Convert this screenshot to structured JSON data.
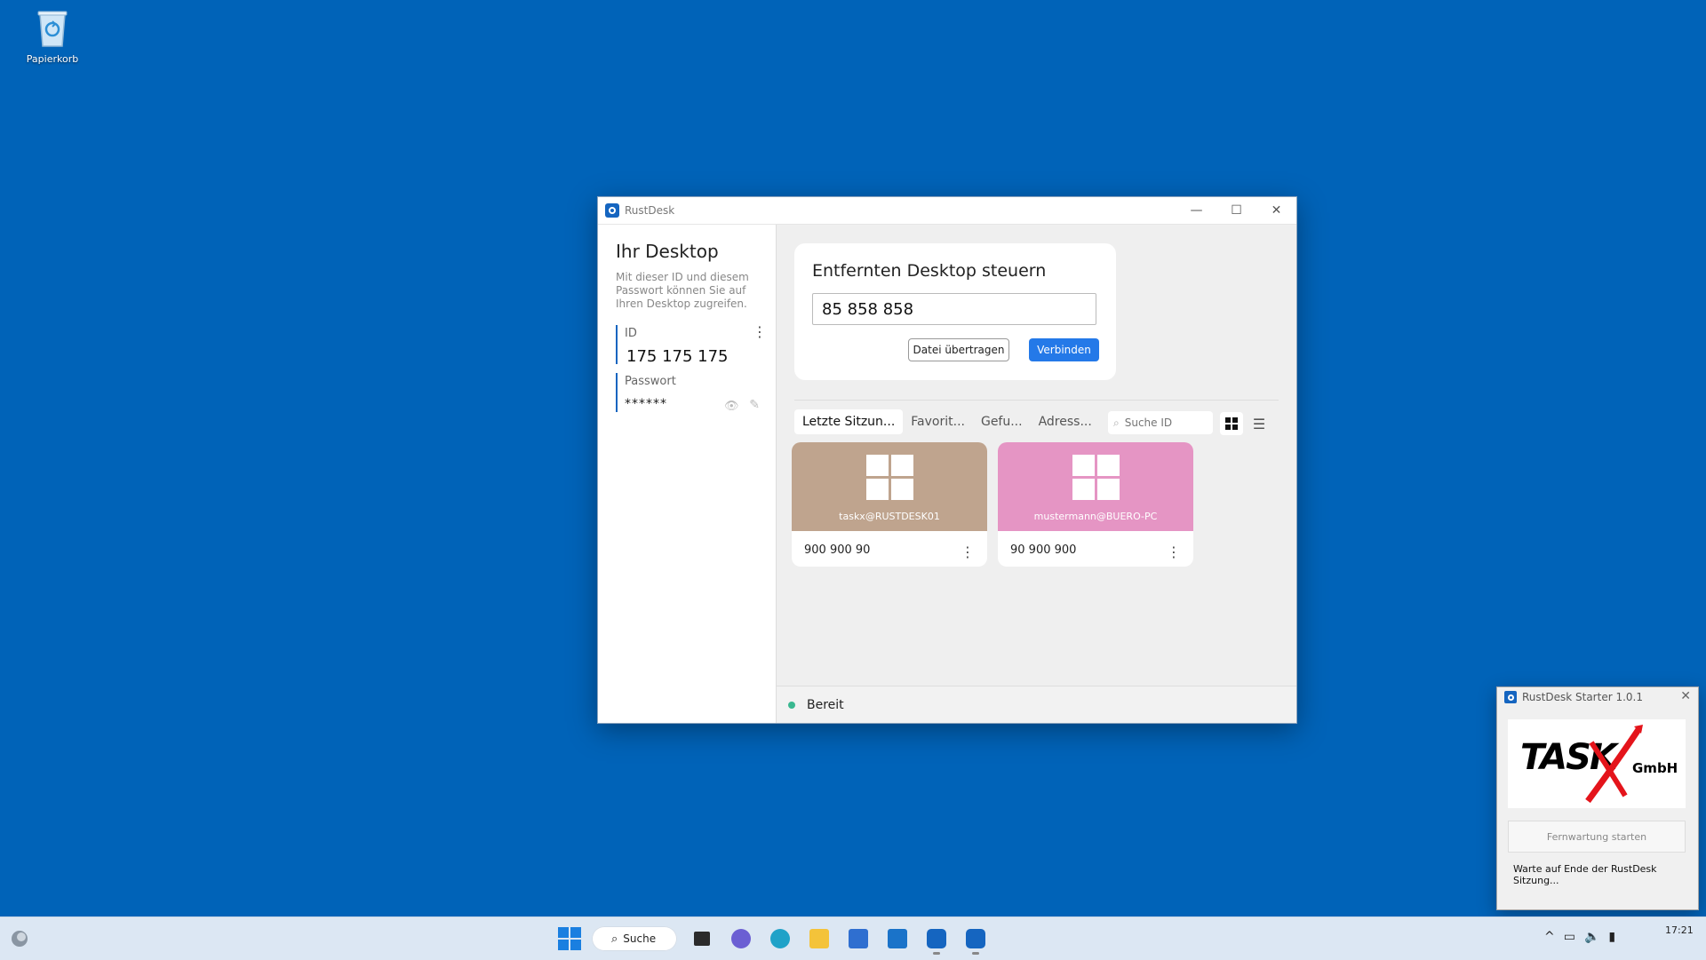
{
  "desktop": {
    "recycle_bin_label": "Papierkorb"
  },
  "window": {
    "title": "RustDesk",
    "controls": {
      "minimize": "—",
      "maximize": "☐",
      "close": "✕"
    }
  },
  "left_panel": {
    "heading": "Ihr Desktop",
    "description": "Mit dieser ID und diesem Passwort können Sie auf Ihren Desktop zugreifen.",
    "id_label": "ID",
    "id_value": "175 175 175",
    "password_label": "Passwort",
    "password_value": "******"
  },
  "connect_card": {
    "heading": "Entfernten Desktop steuern",
    "remote_id_value": "85 858 858",
    "transfer_button": "Datei übertragen",
    "connect_button": "Verbinden"
  },
  "tabs": [
    {
      "label": "Letzte Sitzun...",
      "active": true
    },
    {
      "label": "Favorit...",
      "active": false
    },
    {
      "label": "Gefu...",
      "active": false
    },
    {
      "label": "Adress...",
      "active": false
    }
  ],
  "search": {
    "placeholder": "Suche ID"
  },
  "peers": [
    {
      "user": "taskx@RUSTDESK01",
      "id": "900 900 90",
      "color": "#bfa48e"
    },
    {
      "user": "mustermann@BUERO-PC",
      "id": "90 900 900",
      "color": "#e595c4"
    }
  ],
  "status": {
    "text": "Bereit",
    "led_color": "#3ab890"
  },
  "starter": {
    "title": "RustDesk Starter 1.0.1",
    "logo_text": "TASK",
    "logo_suffix": "GmbH",
    "start_button": "Fernwartung starten",
    "wait_text": "Warte auf Ende der RustDesk Sitzung..."
  },
  "taskbar": {
    "search_label": "Suche",
    "clock": "17:21"
  },
  "colors": {
    "desktop_bg": "#0063b8",
    "accent": "#2479e8",
    "brand": "#1565c0"
  }
}
